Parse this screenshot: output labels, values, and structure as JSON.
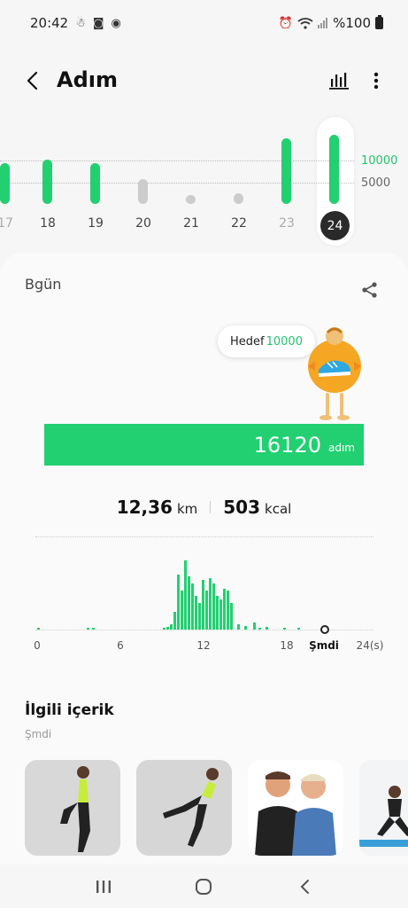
{
  "status_bar": {
    "time": "20:42",
    "battery": "%100"
  },
  "header": {
    "title": "Adım"
  },
  "icons": {
    "back": "chevron-left-icon",
    "stats": "bar-chart-icon",
    "more": "more-vertical-icon",
    "share": "share-icon"
  },
  "week": {
    "ref_high": "10000",
    "ref_low": "5000",
    "days": [
      {
        "label": "17",
        "goal_met": true
      },
      {
        "label": "18",
        "goal_met": true
      },
      {
        "label": "19",
        "goal_met": true
      },
      {
        "label": "20",
        "goal_met": false
      },
      {
        "label": "21",
        "goal_met": false
      },
      {
        "label": "22",
        "goal_met": false
      },
      {
        "label": "23",
        "goal_met": true
      },
      {
        "label": "24",
        "goal_met": true,
        "selected": true
      }
    ]
  },
  "today": {
    "title": "Bgün",
    "goal_label": "Hedef",
    "goal_value": "10000",
    "steps": "16120",
    "steps_unit": "adım",
    "distance": "12,36",
    "distance_unit": "km",
    "calories": "503",
    "calories_unit": "kcal"
  },
  "hourly_chart": {
    "x_labels": [
      "0",
      "6",
      "12",
      "18",
      "Şmdi",
      "24(s)"
    ],
    "accent": "#22d071"
  },
  "related": {
    "title": "İlgili içerik",
    "subtitle": "Şmdi"
  },
  "colors": {
    "accent": "#22d071",
    "inactive": "#cccccc"
  }
}
